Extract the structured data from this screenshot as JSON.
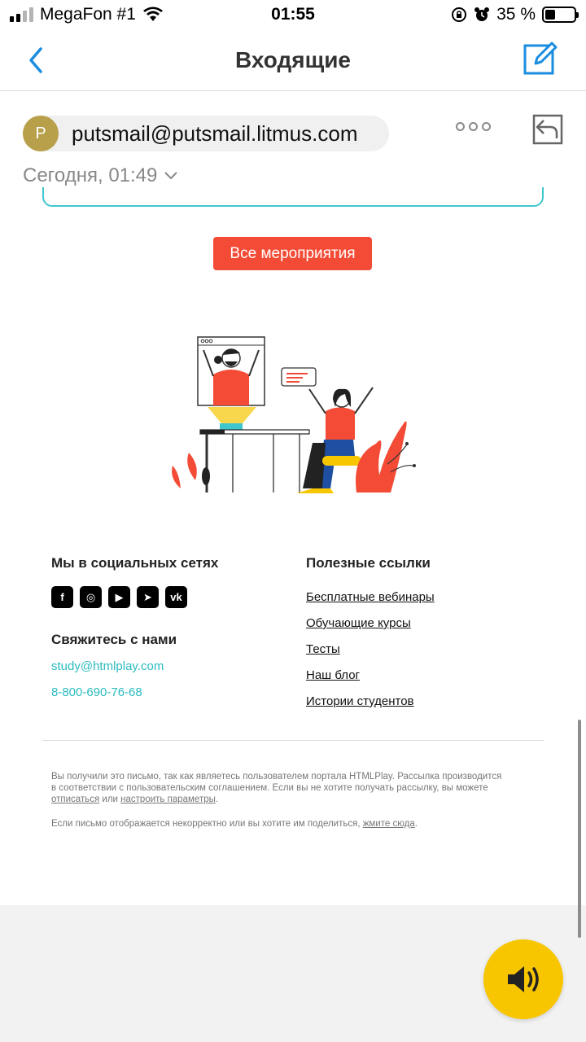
{
  "status_bar": {
    "carrier": "MegaFon #1",
    "time": "01:55",
    "battery": "35 %",
    "battery_level": 0.35
  },
  "nav": {
    "title": "Входящие",
    "icons": [
      "chevron-left-icon",
      "compose-icon"
    ]
  },
  "message": {
    "avatar_letter": "P",
    "sender": "putsmail@putsmail.litmus.com",
    "date": "Сегодня, 01:49"
  },
  "email": {
    "events_button": "Все мероприятия",
    "social": {
      "title": "Мы в социальных сетях",
      "networks": [
        {
          "icon": "facebook-icon",
          "glyph": "f"
        },
        {
          "icon": "instagram-icon",
          "glyph": "◎"
        },
        {
          "icon": "youtube-icon",
          "glyph": "▶"
        },
        {
          "icon": "telegram-icon",
          "glyph": "➤"
        },
        {
          "icon": "vk-icon",
          "glyph": "vk"
        }
      ]
    },
    "contact": {
      "title": "Свяжитесь с нами",
      "email": "study@htmlplay.com",
      "phone": "8-800-690-76-68"
    },
    "links": {
      "title": "Полезные ссылки",
      "items": [
        "Бесплатные вебинары",
        "Обучающие курсы",
        "Тесты",
        "Наш блог",
        "Истории студентов"
      ]
    },
    "disclaimer": {
      "line1": "Вы получили это письмо, так как являетесь пользователем портала HTMLPlay. Рассылка производится",
      "line2": "в соответствии с пользовательским соглашением. Если вы не хотите получать рассылку, вы можете",
      "unsubscribe": "отписаться",
      "or": "или",
      "settings": "настроить параметры",
      "period": ".",
      "line3_prefix": "Если письмо отображается некорректно или вы хотите им поделиться,",
      "click_here": "жмите сюда",
      "period2": "."
    }
  },
  "colors": {
    "accent_blue": "#1a8de0",
    "button_red": "#f44b36",
    "link_cyan": "#2cbcbf",
    "speaker_yellow": "#f7c600"
  }
}
